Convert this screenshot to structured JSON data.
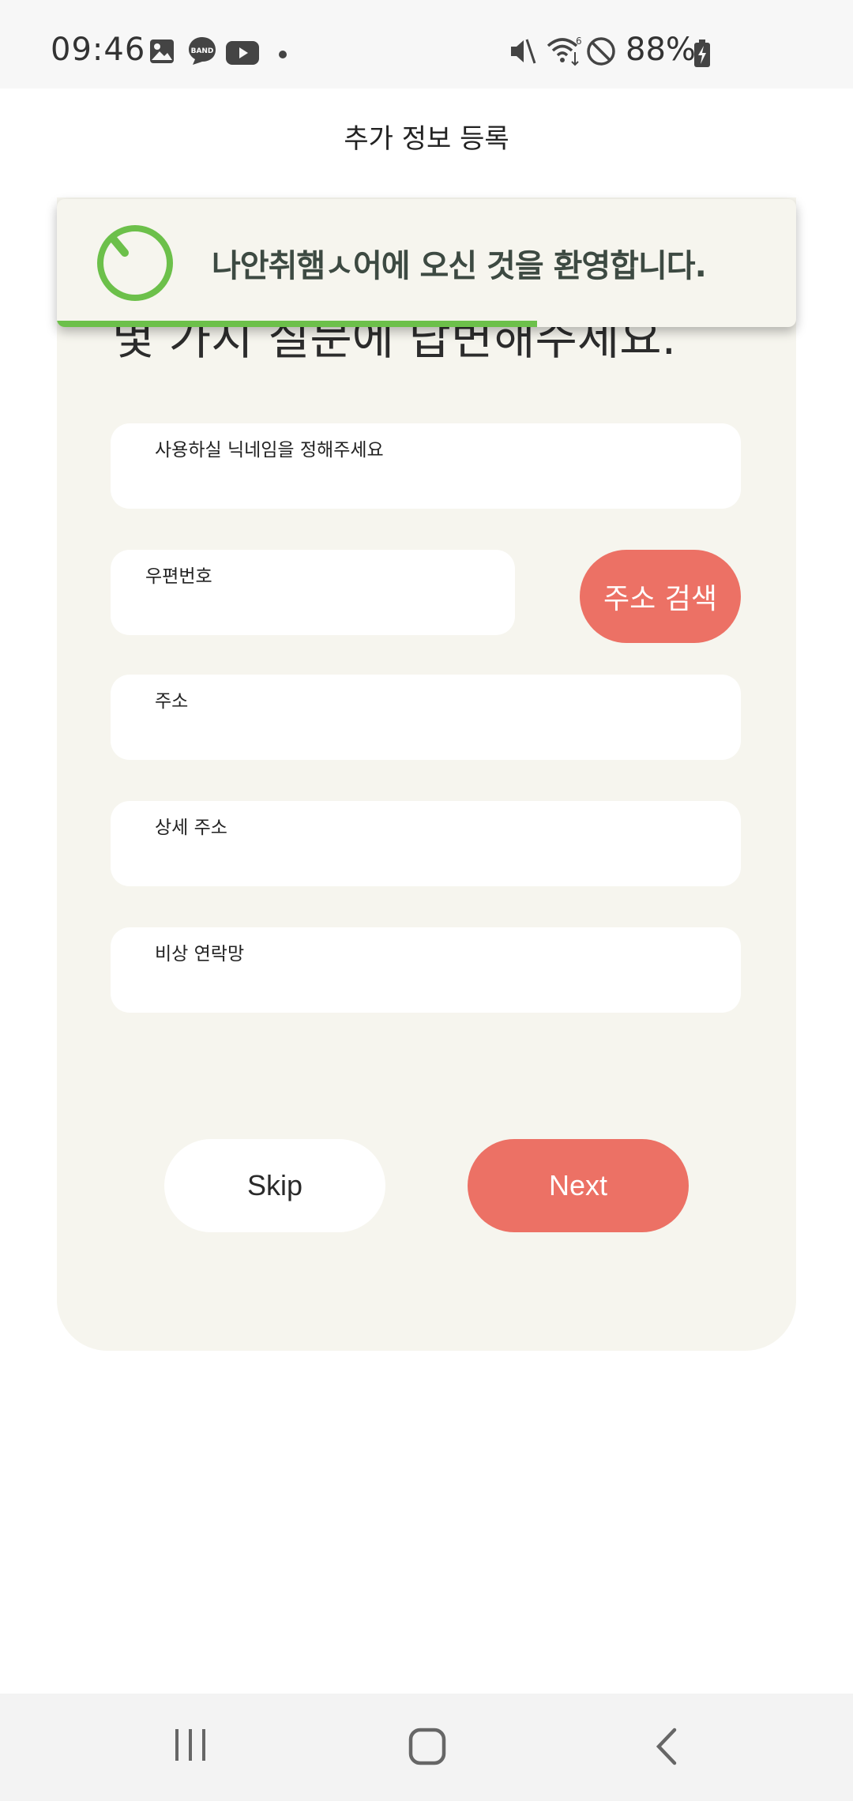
{
  "status_bar": {
    "time": "09:46",
    "battery": "88%",
    "left_icons": [
      "gallery-icon",
      "band-icon",
      "youtube-icon",
      "dot-icon"
    ],
    "right_icons": [
      "mute-icon",
      "wifi-icon",
      "block-icon",
      "battery-icon"
    ],
    "band_label": "BAND"
  },
  "header": {
    "title": "추가 정보 등록"
  },
  "intro": {
    "text_visible": "몇 가지 질문에 답변해주세요."
  },
  "form": {
    "nickname_label": "사용하실 닉네임을 정해주세요",
    "zipcode_label": "우편번호",
    "address_search_label": "주소 검색",
    "address_label": "주소",
    "detail_address_label": "상세 주소",
    "emergency_contact_label": "비상 연락망"
  },
  "buttons": {
    "skip": "Skip",
    "next": "Next"
  },
  "toast": {
    "message": "나안취햄ㅅ어에 오신 것을 환영합니다.",
    "progress": 0.65,
    "accent_color": "#6cc04a"
  },
  "colors": {
    "primary": "#ec7165",
    "card_bg": "#f6f5ee"
  },
  "navbar": {
    "icons": [
      "recent-apps-icon",
      "home-icon",
      "back-icon"
    ]
  }
}
